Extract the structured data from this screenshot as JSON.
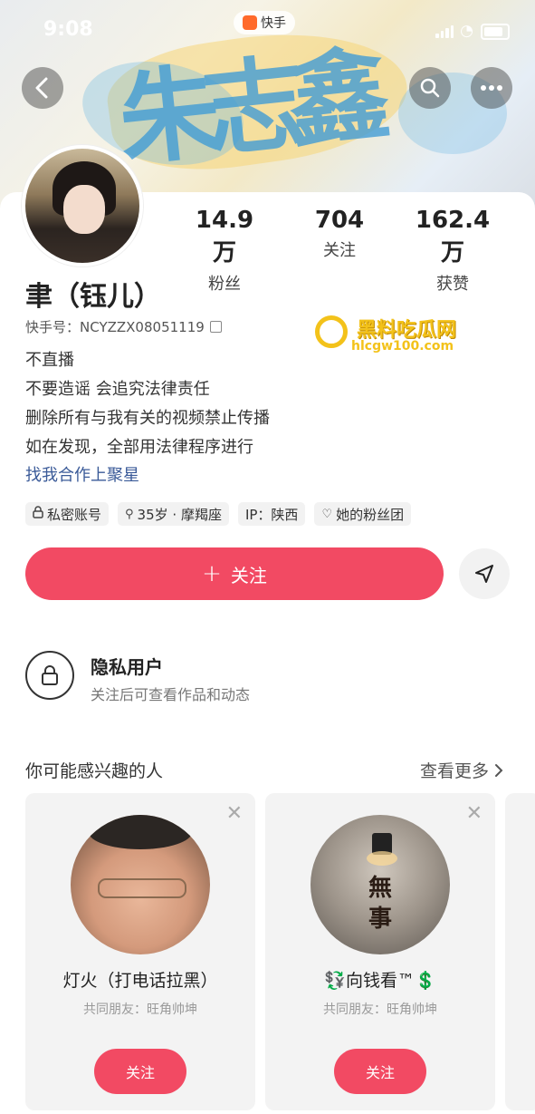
{
  "status_bar": {
    "time": "9:08",
    "app_name": "快手"
  },
  "banner": {
    "brush_text": "朱志鑫"
  },
  "nav": {
    "back_icon": "chevron-left-icon",
    "search_icon": "search-icon",
    "more_icon": "more-icon"
  },
  "profile": {
    "name": "聿（钰儿）",
    "kuaishou_id_label": "快手号：",
    "kuaishou_id": "NCYZZX08051119",
    "stats": [
      {
        "value": "14.9万",
        "label": "粉丝"
      },
      {
        "value": "704",
        "label": "关注"
      },
      {
        "value": "162.4万",
        "label": "获赞"
      }
    ],
    "bio": [
      "不直播",
      "不要造谣 会追究法律责任",
      "删除所有与我有关的视频禁止传播",
      "如在发现，全部用法律程序进行"
    ],
    "bio_link": "找我合作上聚星",
    "tags": [
      {
        "icon": "🔒",
        "text": "私密账号"
      },
      {
        "icon": "⚲",
        "text": "35岁 · 摩羯座"
      },
      {
        "icon": "",
        "text": "IP：陕西"
      },
      {
        "icon": "♡",
        "text": "她的粉丝团"
      }
    ]
  },
  "watermark": {
    "title": "黑料吃瓜网",
    "url": "hlcgw100.com"
  },
  "actions": {
    "follow_label": "关注",
    "follow_plus": "+"
  },
  "private_notice": {
    "title": "隐私用户",
    "subtitle": "关注后可查看作品和动态"
  },
  "recommendations": {
    "title": "你可能感兴趣的人",
    "see_more": "查看更多",
    "people": [
      {
        "name": "灯火（打电话拉黑）",
        "mutual": "共同朋友：旺角帅坤",
        "button": "关注"
      },
      {
        "name": "💱向钱看™💲",
        "mutual": "共同朋友：旺角帅坤",
        "button": "关注",
        "avatar_text": "無\n事"
      }
    ]
  },
  "colors": {
    "accent": "#f24a63",
    "link": "#3a5a98",
    "watermark": "#f3c21a"
  }
}
